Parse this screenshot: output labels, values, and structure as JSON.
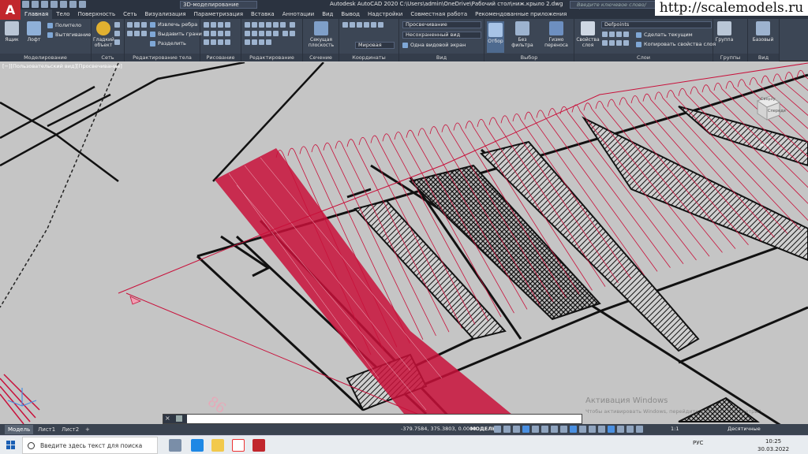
{
  "title_bar": {
    "app_letter": "A",
    "workspace": "3D-моделирование",
    "title": "Autodesk AutoCAD 2020    C:\\Users\\admin\\OneDrive\\Рабочий стол\\ниж.крыло 2.dwg",
    "search_placeholder": "Введите ключевое слово/фразу",
    "watermark": "http://scalemodels.ru"
  },
  "tabs": [
    "Главная",
    "Тело",
    "Поверхность",
    "Сеть",
    "Визуализация",
    "Параметризация",
    "Вставка",
    "Аннотации",
    "Вид",
    "Вывод",
    "Надстройки",
    "Совместная работа",
    "Рекомендованные приложения"
  ],
  "ribbon": {
    "modeling": {
      "title": "Моделирование",
      "box": "Ящик",
      "loft": "Лофт",
      "polysolid": "Политело",
      "extrude": "Вытягивание"
    },
    "mesh": {
      "title": "Сеть",
      "smooth": "Гладкий объект"
    },
    "solid_edit": {
      "title": "Редактирование тела",
      "extract_edges": "Извлечь ребра",
      "extrude_faces": "Выдавить грани",
      "separate": "Разделить"
    },
    "draw": {
      "title": "Рисование"
    },
    "modify": {
      "title": "Редактирование"
    },
    "section": {
      "title": "Сечение",
      "section_plane": "Секущая плоскость"
    },
    "coordinates": {
      "title": "Координаты",
      "ucs": "Мировая"
    },
    "view": {
      "title": "Вид",
      "visual_style": "Просвечивание",
      "saved_view": "Несохраненный вид",
      "viewport": "Одна видовой экран"
    },
    "selection": {
      "title": "Выбор",
      "culling": "Отбор",
      "no_filter": "Без фильтра",
      "gizmo": "Гизмо переноса"
    },
    "layers": {
      "title": "Слои",
      "properties": "Свойства слоя",
      "layer_name": "Defpoints",
      "make_current": "Сделать текущим",
      "match_layer": "Копировать свойства слоя"
    },
    "groups": {
      "title": "Группы",
      "group": "Группа"
    },
    "base": {
      "title": "Вид",
      "base": "Базовый"
    }
  },
  "viewport": {
    "label": "[−][Пользовательский вид][Просвечивание]",
    "viewcube_top": "Сверху",
    "viewcube_front": "Спереди",
    "ucs": "МСК",
    "activate_title": "Активация Windows",
    "activate_sub": "Чтобы активировать Windows, перейдите в раздел \"Параметры\"."
  },
  "command_line": {
    "prompt": ""
  },
  "layout_tabs": [
    "Модель",
    "Лист1",
    "Лист2",
    "+"
  ],
  "status": {
    "coords": "-379.7584, 375.3803, 0.0000",
    "model": "МОДЕЛЬ",
    "scale": "1:1",
    "units": "Десятичные"
  },
  "taskbar": {
    "search_text": "Введите здесь текст для поиска",
    "tray_text": "РУС",
    "time": "10:25",
    "date": "30.03.2022"
  },
  "colors": {
    "accent_red": "#c1272d",
    "ribbon": "#3c4655",
    "canvas": "#c5c5c5",
    "wire_red": "#c8103a"
  }
}
